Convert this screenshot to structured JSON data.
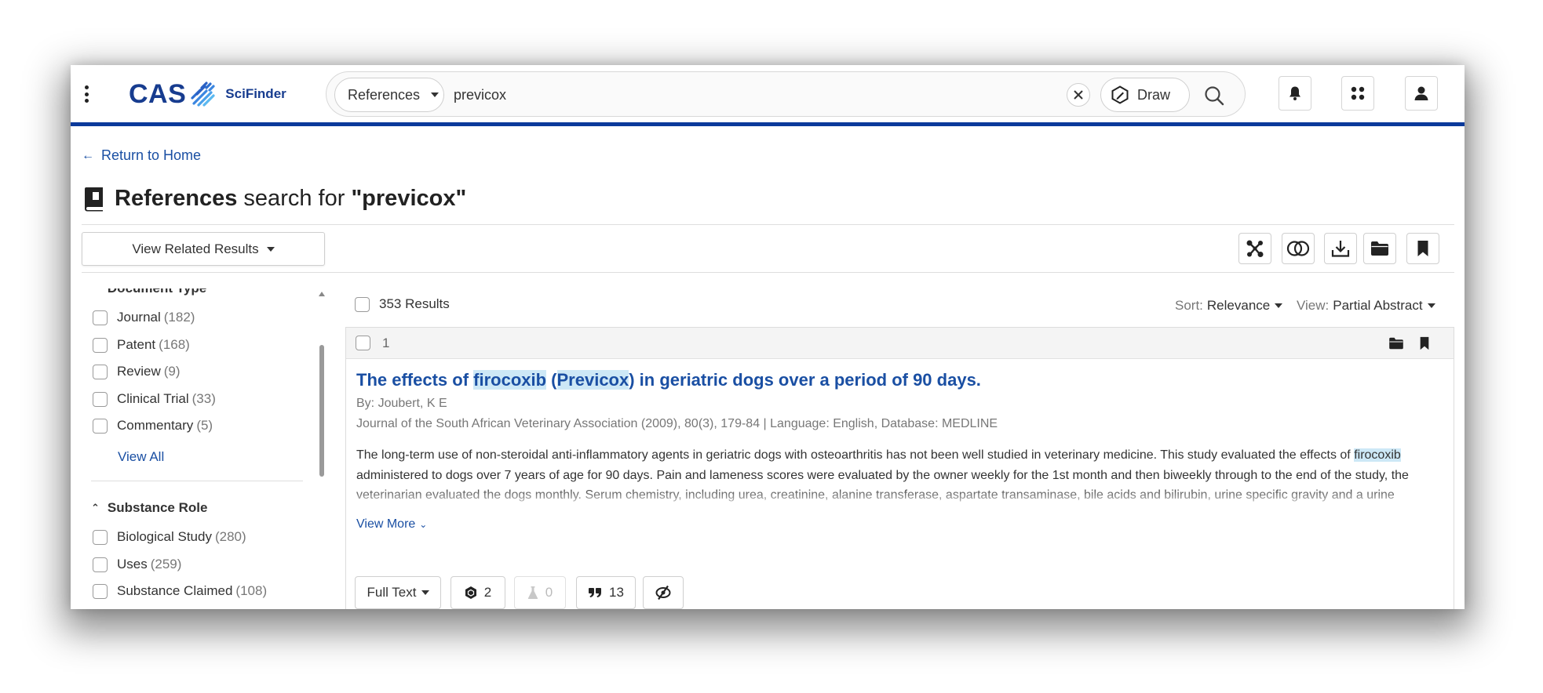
{
  "header": {
    "logo_text": "CAS",
    "product": "SciFinder",
    "search_type": "References",
    "query": "previcox",
    "draw_label": "Draw",
    "icons": [
      "kebab-menu-icon",
      "close-icon",
      "draw-icon",
      "search-icon",
      "bell-icon",
      "apps-icon",
      "user-icon"
    ]
  },
  "nav": {
    "return_label": "Return to Home"
  },
  "page": {
    "title_type": "References",
    "title_mid": " search for ",
    "title_query": "\"previcox\"",
    "related_label": "View Related Results"
  },
  "filters": {
    "document_type": {
      "title": "Document Type",
      "options": [
        {
          "label": "Journal",
          "count": "(182)"
        },
        {
          "label": "Patent",
          "count": "(168)"
        },
        {
          "label": "Review",
          "count": "(9)"
        },
        {
          "label": "Clinical Trial",
          "count": "(33)"
        },
        {
          "label": "Commentary",
          "count": "(5)"
        }
      ],
      "view_all": "View All"
    },
    "substance_role": {
      "title": "Substance Role",
      "options": [
        {
          "label": "Biological Study",
          "count": "(280)"
        },
        {
          "label": "Uses",
          "count": "(259)"
        },
        {
          "label": "Substance Claimed",
          "count": "(108)"
        }
      ]
    }
  },
  "results": {
    "count_label": "353 Results",
    "sort_prefix": "Sort:",
    "sort_value": "Relevance",
    "view_prefix": "View:",
    "view_value": "Partial Abstract"
  },
  "article": {
    "number": "1",
    "title_parts": [
      "The effects of ",
      "firocoxib",
      " (",
      "Previcox",
      ") in geriatric dogs over a period of 90 days."
    ],
    "authors": "By: Joubert, K E",
    "source": "Journal of the South African Veterinary Association (2009), 80(3), 179-84 | Language: English, Database: MEDLINE",
    "abstract_parts": [
      "The long-term use of non-steroidal anti-inflammatory agents in geriatric dogs with osteoarthritis has not been well studied in veterinary medicine. This study evaluated the effects of ",
      "firocoxib",
      " administered to dogs over 7 years of age for 90 days. Pain and lameness scores were evaluated by the owner weekly for the 1st month and then biweekly through to the end of the study, the veterinarian evaluated the dogs monthly. Serum chemistry, including urea, creatinine, alanine transferase, aspartate transaminase, bile acids and bilirubin, urine specific gravity and a urine dipstick, were performed at ..."
    ],
    "view_more": "View More",
    "full_text": "Full Text",
    "substances_count": "2",
    "reactions_count": "0",
    "citations_count": "13"
  },
  "colors": {
    "brand": "#173c8f",
    "link": "#1a4fa3",
    "header_rule": "#0b3a9b",
    "highlight": "#cde8f6"
  }
}
